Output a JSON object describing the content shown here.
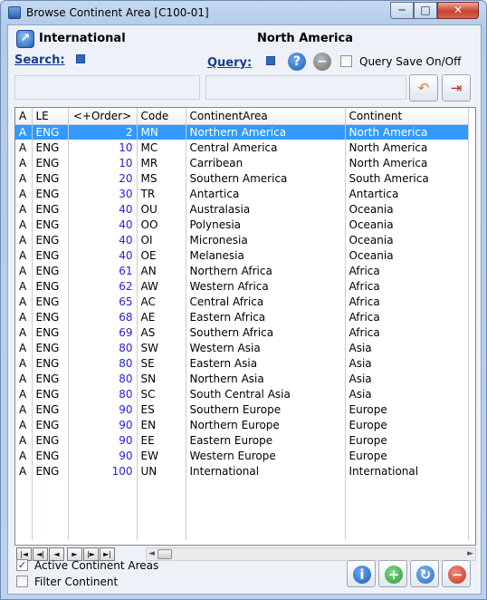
{
  "window": {
    "title": "Browse Continent Area [C100-01]",
    "buttons": {
      "minimize": "─",
      "maximize": "□",
      "close": "✕"
    }
  },
  "header": {
    "context_label": "International",
    "selected_name": "North America",
    "search_label": "Search:",
    "query_label": "Query:",
    "query_save_label": "Query Save On/Off",
    "query_save_checked": false
  },
  "grid": {
    "columns": [
      "A",
      "LE",
      "<+Order>",
      "Code",
      "ContinentArea",
      "Continent"
    ],
    "selected_index": 0,
    "rows": [
      [
        "A",
        "ENG",
        "2",
        "MN",
        "Northern America",
        "North America"
      ],
      [
        "A",
        "ENG",
        "10",
        "MC",
        "Central America",
        "North America"
      ],
      [
        "A",
        "ENG",
        "10",
        "MR",
        "Carribean",
        "North America"
      ],
      [
        "A",
        "ENG",
        "20",
        "MS",
        "Southern America",
        "South America"
      ],
      [
        "A",
        "ENG",
        "30",
        "TR",
        "Antartica",
        "Antartica"
      ],
      [
        "A",
        "ENG",
        "40",
        "OU",
        "Australasia",
        "Oceania"
      ],
      [
        "A",
        "ENG",
        "40",
        "OO",
        "Polynesia",
        "Oceania"
      ],
      [
        "A",
        "ENG",
        "40",
        "OI",
        "Micronesia",
        "Oceania"
      ],
      [
        "A",
        "ENG",
        "40",
        "OE",
        "Melanesia",
        "Oceania"
      ],
      [
        "A",
        "ENG",
        "61",
        "AN",
        "Northern Africa",
        "Africa"
      ],
      [
        "A",
        "ENG",
        "62",
        "AW",
        "Western Africa",
        "Africa"
      ],
      [
        "A",
        "ENG",
        "65",
        "AC",
        "Central Africa",
        "Africa"
      ],
      [
        "A",
        "ENG",
        "68",
        "AE",
        "Eastern Africa",
        "Africa"
      ],
      [
        "A",
        "ENG",
        "69",
        "AS",
        "Southern Africa",
        "Africa"
      ],
      [
        "A",
        "ENG",
        "80",
        "SW",
        "Western Asia",
        "Asia"
      ],
      [
        "A",
        "ENG",
        "80",
        "SE",
        "Eastern Asia",
        "Asia"
      ],
      [
        "A",
        "ENG",
        "80",
        "SN",
        "Northern Asia",
        "Asia"
      ],
      [
        "A",
        "ENG",
        "80",
        "SC",
        "South Central Asia",
        "Asia"
      ],
      [
        "A",
        "ENG",
        "90",
        "ES",
        "Southern Europe",
        "Europe"
      ],
      [
        "A",
        "ENG",
        "90",
        "EN",
        "Northern Europe",
        "Europe"
      ],
      [
        "A",
        "ENG",
        "90",
        "EE",
        "Eastern Europe",
        "Europe"
      ],
      [
        "A",
        "ENG",
        "90",
        "EW",
        "Western Europe",
        "Europe"
      ],
      [
        "A",
        "ENG",
        "100",
        "UN",
        "International",
        "International"
      ]
    ]
  },
  "navigator": {
    "buttons": [
      "|◄",
      "◄|",
      "◄",
      "►",
      "|►",
      "►|"
    ]
  },
  "footer": {
    "active_label": "Active Continent Areas",
    "active_checked": true,
    "filter_label": "Filter Continent",
    "filter_checked": false
  },
  "colors": {
    "selection": "#3399ff",
    "order_text": "#2424d8",
    "info_blue": "#1f5fb5",
    "add_green": "#2e9a3a",
    "delete_red": "#c8321f"
  },
  "icons": {
    "context": "international-icon",
    "search": "search-field-icon",
    "query": "query-field-icon",
    "help": "help-icon",
    "clear": "minus-icon",
    "recall": "recall-arrow-icon",
    "exit": "exit-door-icon",
    "info": "info-icon",
    "add": "add-icon",
    "refresh": "refresh-icon",
    "delete": "delete-icon"
  }
}
